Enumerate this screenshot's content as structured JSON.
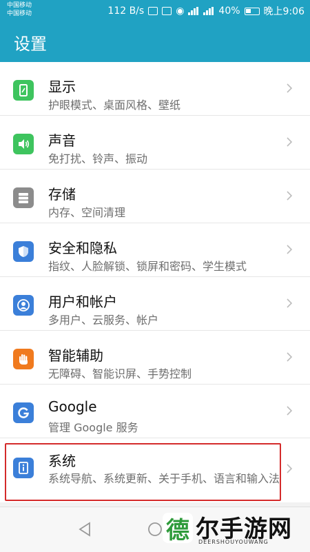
{
  "status_bar": {
    "carrier1": "中国移动",
    "carrier2": "中国移动",
    "speed": "112 B/s",
    "battery": "40%",
    "time": "晚上9:06"
  },
  "header": {
    "title": "设置"
  },
  "settings": [
    {
      "title": "显示",
      "subtitle": "护眼模式、桌面风格、壁纸",
      "icon": "display-icon",
      "color": "#3ec45e"
    },
    {
      "title": "声音",
      "subtitle": "免打扰、铃声、振动",
      "icon": "sound-icon",
      "color": "#3ec45e"
    },
    {
      "title": "存储",
      "subtitle": "内存、空间清理",
      "icon": "storage-icon",
      "color": "#8c8c8c"
    },
    {
      "title": "安全和隐私",
      "subtitle": "指纹、人脸解锁、锁屏和密码、学生模式",
      "icon": "shield-icon",
      "color": "#3b7fd9"
    },
    {
      "title": "用户和帐户",
      "subtitle": "多用户、云服务、帐户",
      "icon": "user-icon",
      "color": "#3b7fd9"
    },
    {
      "title": "智能辅助",
      "subtitle": "无障碍、智能识屏、手势控制",
      "icon": "hand-icon",
      "color": "#f07a1e"
    },
    {
      "title": "Google",
      "subtitle": "管理 Google 服务",
      "icon": "google-icon",
      "color": "#3b7fd9"
    },
    {
      "title": "系统",
      "subtitle": "系统导航、系统更新、关于手机、语言和输入法",
      "icon": "info-icon",
      "color": "#3b7fd9"
    }
  ],
  "watermark": {
    "text": "尔手游网",
    "logo": "德",
    "sub": "DEERSHOUYOUWANG"
  }
}
